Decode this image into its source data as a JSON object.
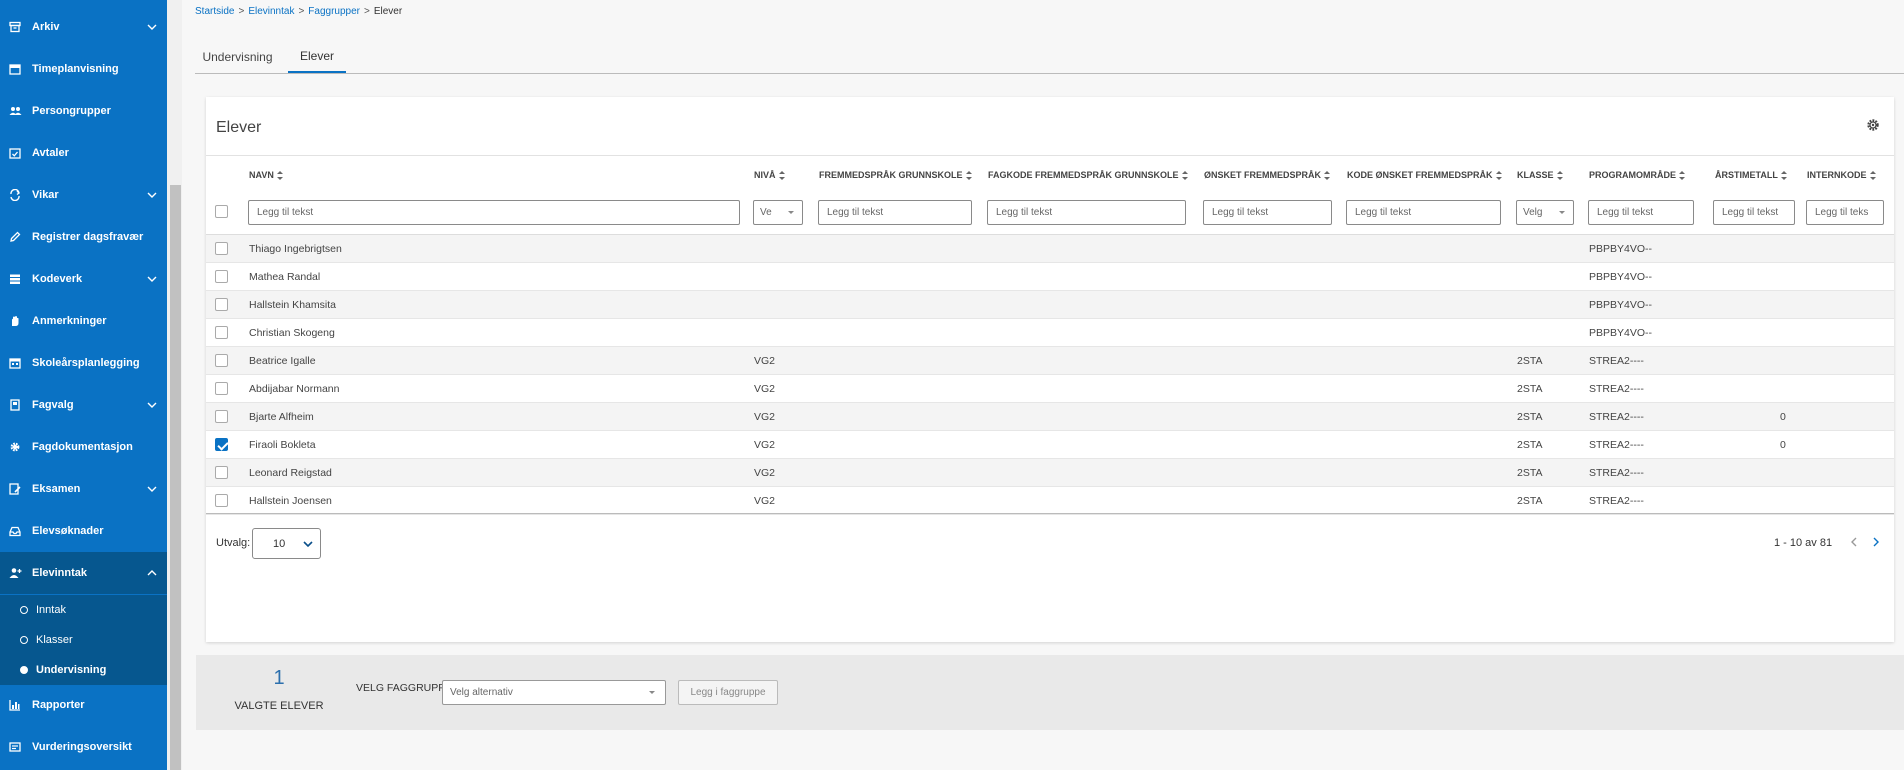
{
  "sidebar": {
    "items": [
      {
        "label": "Arkiv",
        "icon": "archive-icon",
        "expandable": true
      },
      {
        "label": "Timeplanvisning",
        "icon": "calendar-icon",
        "expandable": false
      },
      {
        "label": "Persongrupper",
        "icon": "people-icon",
        "expandable": false
      },
      {
        "label": "Avtaler",
        "icon": "calendar-check-icon",
        "expandable": false
      },
      {
        "label": "Vikar",
        "icon": "swap-icon",
        "expandable": true
      },
      {
        "label": "Registrer dagsfravær",
        "icon": "pencil-icon",
        "expandable": false
      },
      {
        "label": "Kodeverk",
        "icon": "layers-icon",
        "expandable": true
      },
      {
        "label": "Anmerkninger",
        "icon": "hand-icon",
        "expandable": false
      },
      {
        "label": "Skoleårsplanlegging",
        "icon": "calendar-grid-icon",
        "expandable": false
      },
      {
        "label": "Fagvalg",
        "icon": "book-icon",
        "expandable": true
      },
      {
        "label": "Fagdokumentasjon",
        "icon": "gear-icon",
        "expandable": false
      },
      {
        "label": "Eksamen",
        "icon": "exam-icon",
        "expandable": true
      },
      {
        "label": "Elevsøknader",
        "icon": "inbox-icon",
        "expandable": false
      },
      {
        "label": "Elevinntak",
        "icon": "user-add-icon",
        "expandable": true,
        "expanded": true
      },
      {
        "label": "Rapporter",
        "icon": "bar-chart-icon",
        "expandable": false
      },
      {
        "label": "Vurderingsoversikt",
        "icon": "checklist-icon",
        "expandable": false
      }
    ],
    "subitems": [
      {
        "label": "Inntak",
        "active": false
      },
      {
        "label": "Klasser",
        "active": false
      },
      {
        "label": "Undervisning",
        "active": true
      }
    ]
  },
  "breadcrumb": {
    "items": [
      "Startside",
      "Elevinntak",
      "Faggrupper"
    ],
    "current": "Elever"
  },
  "tabs": [
    {
      "label": "Undervisning",
      "active": false
    },
    {
      "label": "Elever",
      "active": true
    }
  ],
  "table": {
    "title": "Elever",
    "columns": [
      "NAVN",
      "NIVÅ",
      "FREMMEDSPRÅK GRUNNSKOLE",
      "FAGKODE FREMMEDSPRÅK GRUNNSKOLE",
      "ØNSKET FREMMEDSPRÅK",
      "KODE ØNSKET FREMMEDSPRÅK",
      "KLASSE",
      "PROGRAMOMRÅDE",
      "ÅRSTIMETALL",
      "INTERNKODE"
    ],
    "filter_placeholder": "Legg til tekst",
    "filter_placeholder_short": "Legg til teks",
    "select_placeholder_niva": "Ve",
    "select_placeholder_klasse": "Velg",
    "rows": [
      {
        "name": "Thiago Ingebrigtsen",
        "niva": "",
        "klasse": "",
        "program": "PBPBY4VO--",
        "arstimetall": "",
        "checked": false
      },
      {
        "name": "Mathea Randal",
        "niva": "",
        "klasse": "",
        "program": "PBPBY4VO--",
        "arstimetall": "",
        "checked": false
      },
      {
        "name": "Hallstein Khamsita",
        "niva": "",
        "klasse": "",
        "program": "PBPBY4VO--",
        "arstimetall": "",
        "checked": false
      },
      {
        "name": "Christian Skogeng",
        "niva": "",
        "klasse": "",
        "program": "PBPBY4VO--",
        "arstimetall": "",
        "checked": false
      },
      {
        "name": "Beatrice Igalle",
        "niva": "VG2",
        "klasse": "2STA",
        "program": "STREA2----",
        "arstimetall": "",
        "checked": false
      },
      {
        "name": "Abdijabar Normann",
        "niva": "VG2",
        "klasse": "2STA",
        "program": "STREA2----",
        "arstimetall": "",
        "checked": false
      },
      {
        "name": "Bjarte Alfheim",
        "niva": "VG2",
        "klasse": "2STA",
        "program": "STREA2----",
        "arstimetall": "0",
        "checked": false
      },
      {
        "name": "Firaoli Bokleta",
        "niva": "VG2",
        "klasse": "2STA",
        "program": "STREA2----",
        "arstimetall": "0",
        "checked": true
      },
      {
        "name": "Leonard Reigstad",
        "niva": "VG2",
        "klasse": "2STA",
        "program": "STREA2----",
        "arstimetall": "",
        "checked": false
      },
      {
        "name": "Hallstein Joensen",
        "niva": "VG2",
        "klasse": "2STA",
        "program": "STREA2----",
        "arstimetall": "",
        "checked": false
      }
    ]
  },
  "pagination": {
    "utvalg_label": "Utvalg:",
    "page_size": "10",
    "range_text": "1 - 10 av 81"
  },
  "action_panel": {
    "selected_count": "1",
    "selected_label": "VALGTE ELEVER",
    "faggruppe_label": "VELG FAGGRUPPE",
    "faggruppe_placeholder": "Velg alternativ",
    "add_button": "Legg i faggruppe"
  },
  "colors": {
    "sidebar_bg": "#0a72c4",
    "sidebar_expanded_bg": "#06578f",
    "accent": "#0a72c4"
  }
}
